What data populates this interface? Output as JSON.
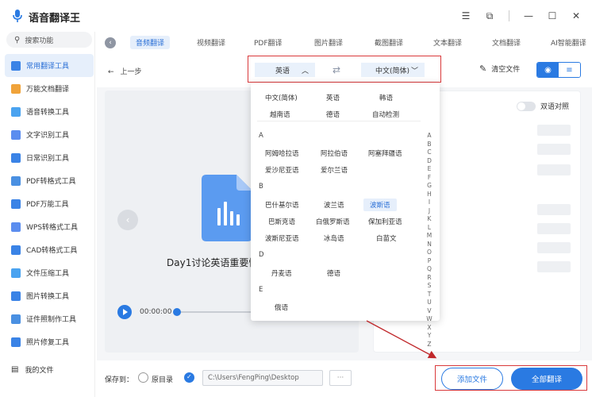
{
  "app": {
    "title": "语音翻译王"
  },
  "window": {
    "menu_icon": "menu-icon",
    "shrink_icon": "shrink-icon",
    "minimize_icon": "minimize-icon",
    "maximize_icon": "maximize-icon",
    "close_icon": "close-icon"
  },
  "sidebar": {
    "search_label": "搜索功能",
    "items": [
      {
        "label": "常用翻译工具",
        "icon": "translate-icon",
        "color": "#3a83e6"
      },
      {
        "label": "万能文档翻译",
        "icon": "doc-icon",
        "color": "#f0a33a"
      },
      {
        "label": "语音转换工具",
        "icon": "voice-icon",
        "color": "#3a83e6"
      },
      {
        "label": "文字识别工具",
        "icon": "text-ocr-icon",
        "color": "#3a83e6"
      },
      {
        "label": "日常识别工具",
        "icon": "scan-icon",
        "color": "#3a83e6"
      },
      {
        "label": "PDF转格式工具",
        "icon": "pdf-convert-icon",
        "color": "#3a83e6"
      },
      {
        "label": "PDF万能工具",
        "icon": "pdf-tool-icon",
        "color": "#3a83e6"
      },
      {
        "label": "WPS转格式工具",
        "icon": "wps-icon",
        "color": "#3a83e6"
      },
      {
        "label": "CAD转格式工具",
        "icon": "cad-icon",
        "color": "#3a83e6"
      },
      {
        "label": "文件压缩工具",
        "icon": "compress-icon",
        "color": "#3a83e6"
      },
      {
        "label": "图片转换工具",
        "icon": "image-convert-icon",
        "color": "#3a83e6"
      },
      {
        "label": "证件照制作工具",
        "icon": "id-photo-icon",
        "color": "#3a83e6"
      },
      {
        "label": "照片修复工具",
        "icon": "photo-repair-icon",
        "color": "#3a83e6"
      }
    ],
    "my_files": "我的文件"
  },
  "tabs": [
    "音频翻译",
    "视频翻译",
    "PDF翻译",
    "图片翻译",
    "截图翻译",
    "文本翻译",
    "文档翻译",
    "AI智能翻译"
  ],
  "toolbar": {
    "prev": "上一步",
    "source_lang": "英语",
    "target_lang": "中文(简体)",
    "clear": "清空文件"
  },
  "player": {
    "file_title": "Day1讨论英语重要性",
    "time": "00:00:00"
  },
  "right": {
    "bilingual": "双语对照"
  },
  "dropdown": {
    "common": [
      "中文(简体)",
      "英语",
      "韩语",
      "越南语",
      "德语",
      "自动检测"
    ],
    "sections": [
      {
        "letter": "A",
        "items": [
          "阿姆哈拉语",
          "阿拉伯语",
          "阿塞拜疆语",
          "爱沙尼亚语",
          "爱尔兰语"
        ]
      },
      {
        "letter": "B",
        "items": [
          "巴什基尔语",
          "波兰语",
          "波斯语",
          "巴斯克语",
          "白俄罗斯语",
          "保加利亚语",
          "波斯尼亚语",
          "冰岛语",
          "白苗文"
        ]
      },
      {
        "letter": "D",
        "items": [
          "丹麦语",
          "德语"
        ]
      },
      {
        "letter": "E",
        "items": [
          "俄语"
        ]
      }
    ],
    "highlighted": "波斯语",
    "alphabet": [
      "A",
      "B",
      "C",
      "D",
      "E",
      "F",
      "G",
      "H",
      "I",
      "J",
      "K",
      "L",
      "M",
      "N",
      "O",
      "P",
      "Q",
      "R",
      "S",
      "T",
      "U",
      "V",
      "W",
      "X",
      "Y",
      "Z"
    ]
  },
  "bottom": {
    "save_to": "保存到：",
    "original_dir": "原目录",
    "path": "C:\\Users\\FengPing\\Desktop",
    "more": "···",
    "add_file": "添加文件",
    "translate_all": "全部翻译"
  },
  "colors": {
    "accent": "#2a7ae2",
    "highlight_box": "#d9393b"
  }
}
